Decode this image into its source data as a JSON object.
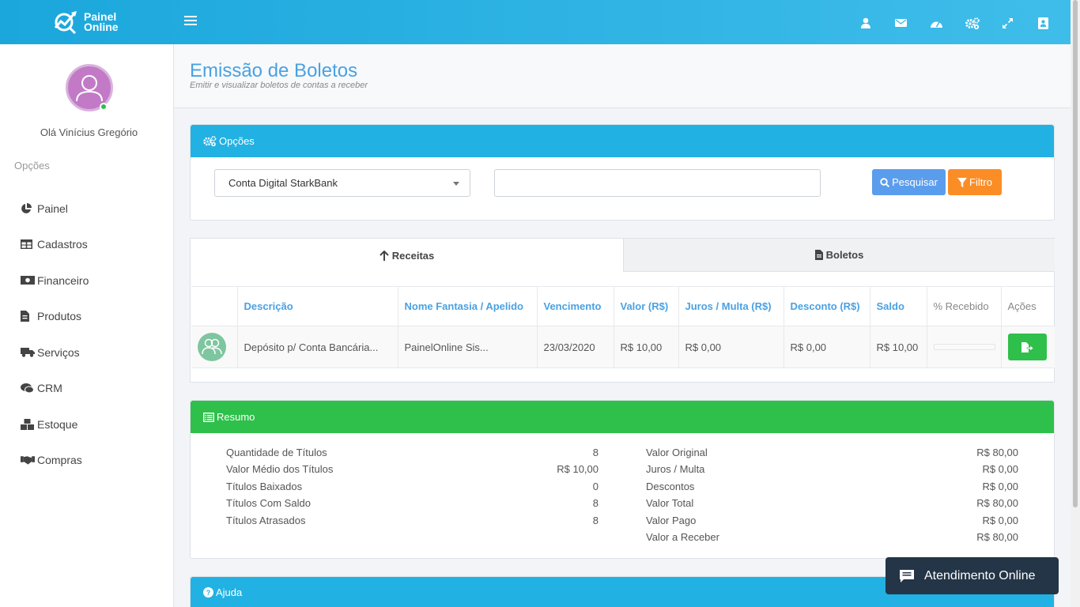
{
  "brand": {
    "line1": "Painel",
    "line2": "Online"
  },
  "topbar": {
    "icons": [
      "user-icon",
      "envelope-icon",
      "dashboard-icon",
      "gears-icon",
      "expand-icon",
      "contact-card-icon"
    ]
  },
  "sidebar": {
    "greeting": "Olá Vinícius Gregório",
    "section_label": "Opções",
    "items": [
      {
        "label": "Painel",
        "icon": "pie-chart-icon"
      },
      {
        "label": "Cadastros",
        "icon": "table-icon"
      },
      {
        "label": "Financeiro",
        "icon": "money-icon"
      },
      {
        "label": "Produtos",
        "icon": "file-icon"
      },
      {
        "label": "Serviços",
        "icon": "truck-icon"
      },
      {
        "label": "CRM",
        "icon": "chat-icon"
      },
      {
        "label": "Estoque",
        "icon": "boxes-icon"
      },
      {
        "label": "Compras",
        "icon": "handshake-icon"
      }
    ]
  },
  "page": {
    "title": "Emissão de Boletos",
    "subtitle": "Emitir e visualizar boletos de contas a receber"
  },
  "options_panel": {
    "title": "Opções",
    "account_selected": "Conta Digital StarkBank",
    "search_value": "",
    "search_button": "Pesquisar",
    "filter_button": "Filtro"
  },
  "tabs": {
    "active": "Receitas",
    "inactive": "Boletos"
  },
  "table": {
    "headers": [
      "",
      "Descrição",
      "Nome Fantasia / Apelido",
      "Vencimento",
      "Valor (R$)",
      "Juros / Multa (R$)",
      "Desconto (R$)",
      "Saldo",
      "% Recebido",
      "Ações"
    ],
    "rows": [
      {
        "descricao": "Depósito p/ Conta Bancária...",
        "nome": "PainelOnline Sis...",
        "vencimento": "23/03/2020",
        "valor": "R$ 10,00",
        "juros": "R$ 0,00",
        "desconto": "R$ 0,00",
        "saldo": "R$ 10,00",
        "recebido_fraction": 0
      }
    ]
  },
  "summary": {
    "title": "Resumo",
    "left": [
      {
        "label": "Quantidade de Títulos",
        "value": "8"
      },
      {
        "label": "Valor Médio dos Títulos",
        "value": "R$ 10,00"
      },
      {
        "label": "Títulos Baixados",
        "value": "0"
      },
      {
        "label": "Títulos Com Saldo",
        "value": "8"
      },
      {
        "label": "Títulos Atrasados",
        "value": "8"
      }
    ],
    "right": [
      {
        "label": "Valor Original",
        "value": "R$ 80,00"
      },
      {
        "label": "Juros / Multa",
        "value": "R$ 0,00"
      },
      {
        "label": "Descontos",
        "value": "R$ 0,00"
      },
      {
        "label": "Valor Total",
        "value": "R$ 80,00"
      },
      {
        "label": "Valor Pago",
        "value": "R$ 0,00"
      },
      {
        "label": "Valor a Receber",
        "value": "R$ 80,00"
      }
    ]
  },
  "help_panel": {
    "title": "Ajuda"
  },
  "chat": {
    "label": "Atendimento Online"
  },
  "colors": {
    "primary": "#22b1e3",
    "success": "#2ec04a",
    "warning": "#fb8d26",
    "title": "#4aa1e2",
    "chat": "#233547"
  }
}
